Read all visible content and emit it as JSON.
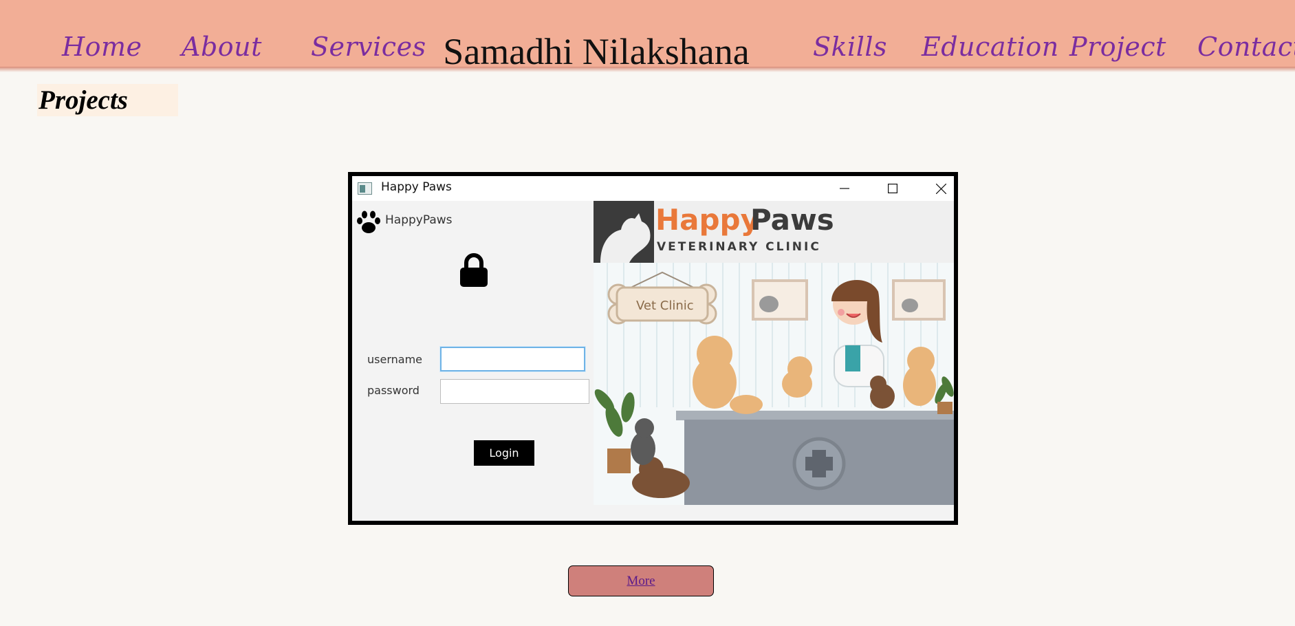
{
  "nav": {
    "title": "Samadhi Nilakshana",
    "links": [
      "Home",
      "About",
      "Services",
      "Skills",
      "Education",
      "Project",
      "Contact"
    ]
  },
  "section": {
    "heading": "Projects"
  },
  "app_window": {
    "title": "Happy Paws",
    "brand": "HappyPaws",
    "username_label": "username",
    "password_label": "password",
    "login_label": "Login",
    "username_value": "",
    "password_value": "",
    "logo_happy": "Happy",
    "logo_paws": "Paws",
    "logo_sub": "VETERINARY CLINIC",
    "sign_text": "Vet Clinic"
  },
  "more_button": {
    "label": "More"
  },
  "colors": {
    "nav_bg": "#f2ae96",
    "link": "#7a2da0",
    "more_bg": "#cf807b",
    "page_bg": "#f9f7f3"
  }
}
